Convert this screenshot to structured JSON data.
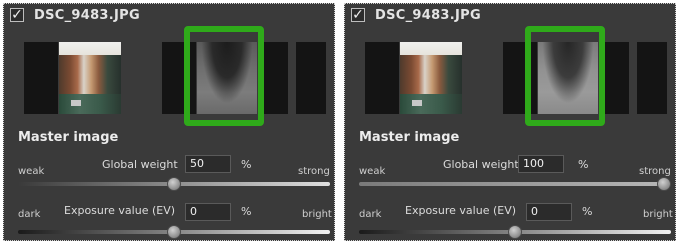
{
  "panels": [
    {
      "filename": "DSC_9483.JPG",
      "checked_glyph": "✓",
      "section_title": "Master image",
      "global_weight": {
        "label_left": "weak",
        "label": "Global weight",
        "value": "50",
        "unit": "%",
        "label_right": "strong",
        "slider_fraction": 0.5
      },
      "exposure": {
        "label_left": "dark",
        "label": "Exposure value (EV)",
        "value": "0",
        "unit": "%",
        "label_right": "bright",
        "slider_fraction": 0.5
      }
    },
    {
      "filename": "DSC_9483.JPG",
      "checked_glyph": "✓",
      "section_title": "Master image",
      "global_weight": {
        "label_left": "weak",
        "label": "Global weight",
        "value": "100",
        "unit": "%",
        "label_right": "strong",
        "slider_fraction": 1.0
      },
      "exposure": {
        "label_left": "dark",
        "label": "Exposure value (EV)",
        "value": "0",
        "unit": "%",
        "label_right": "bright",
        "slider_fraction": 0.5
      }
    }
  ],
  "colors": {
    "selection_border": "#2faa1a",
    "panel_bg": "#3a3a3a"
  }
}
